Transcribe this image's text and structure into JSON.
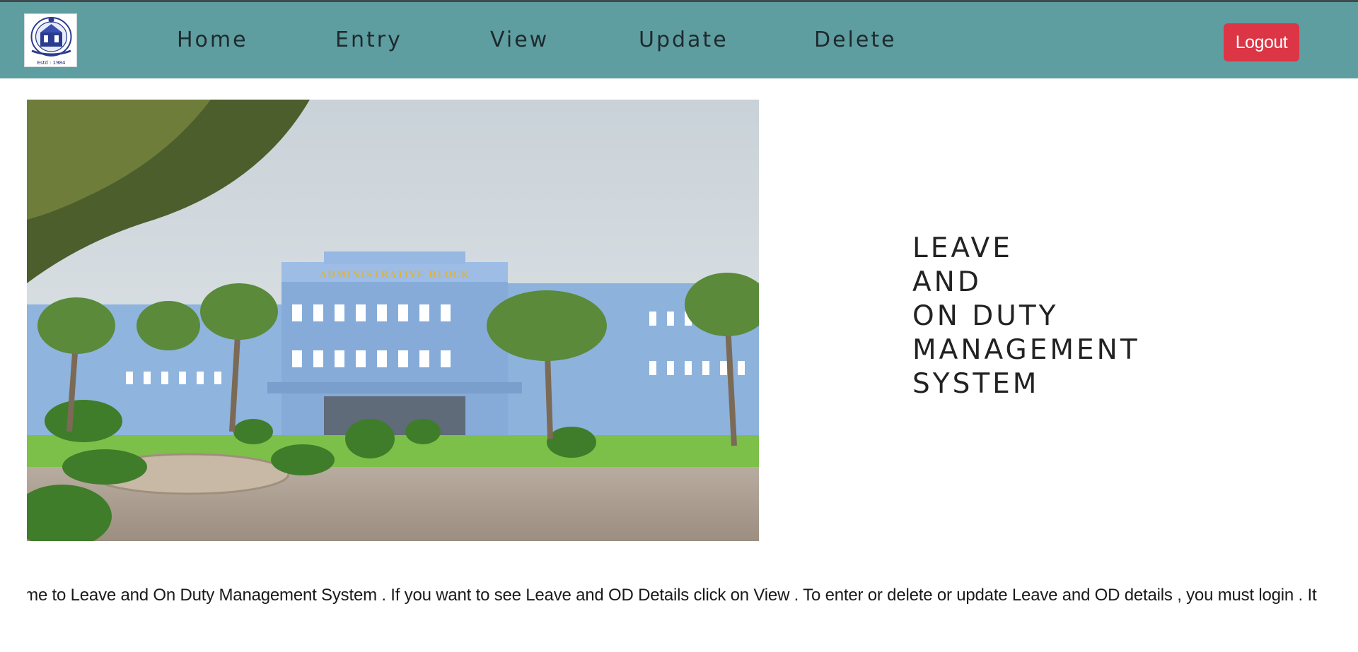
{
  "header": {
    "logo_caption": "Estd : 1984",
    "nav": {
      "home": "Home",
      "entry": "Entry",
      "view": "View",
      "update": "Update",
      "delete": "Delete"
    },
    "logout_label": "Logout"
  },
  "hero": {
    "image_sign_text": "ADMINISTRATIVE BLOCK"
  },
  "title": {
    "line1": "LEAVE",
    "line2": "AND",
    "line3": "ON DUTY",
    "line4": "MANAGEMENT",
    "line5": "SYSTEM"
  },
  "marquee": {
    "text": "ome to Leave and On Duty Management System . If you want to see Leave and OD Details click on View . To enter or delete or update Leave and OD details , you must login . It"
  },
  "colors": {
    "navbar": "#5f9ea0",
    "logout": "#dc3545"
  }
}
